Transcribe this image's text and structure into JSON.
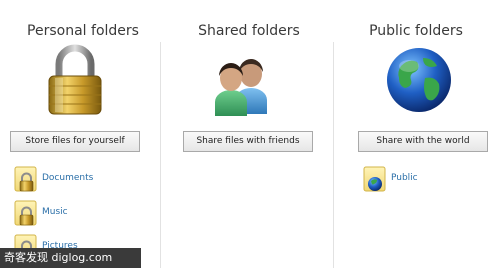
{
  "columns": {
    "personal": {
      "title": "Personal folders",
      "icon": "padlock-icon",
      "button_label": "Store files for yourself",
      "folders": [
        {
          "label": "Documents",
          "icon": "locked-folder-icon"
        },
        {
          "label": "Music",
          "icon": "locked-folder-icon"
        },
        {
          "label": "Pictures",
          "icon": "locked-folder-icon"
        }
      ]
    },
    "shared": {
      "title": "Shared folders",
      "icon": "users-icon",
      "button_label": "Share files with friends"
    },
    "public": {
      "title": "Public folders",
      "icon": "globe-icon",
      "button_label": "Share with the world",
      "folders": [
        {
          "label": "Public",
          "icon": "globe-folder-icon"
        }
      ]
    }
  },
  "watermark": {
    "text": "奇客发现 diglog.com"
  },
  "colors": {
    "link": "#2b6fa8",
    "title": "#3a3a3a",
    "divider": "#e2e2e2",
    "button_border": "#a9a9a9"
  }
}
